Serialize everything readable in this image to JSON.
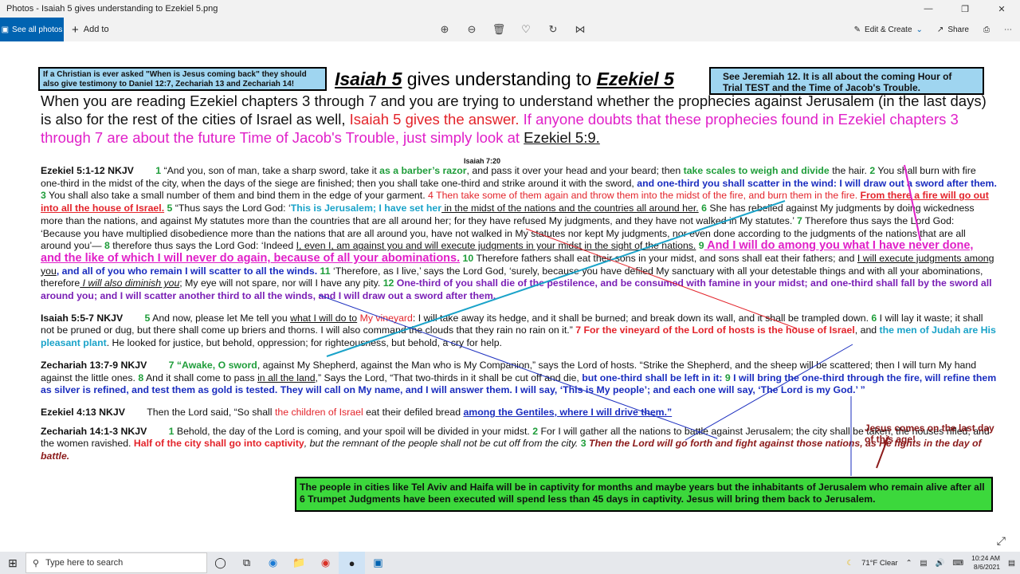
{
  "window": {
    "title": "Photos - Isaiah 5 gives understanding to Ezekiel 5.png"
  },
  "toolbar": {
    "see_all": "See all photos",
    "add_to": "Add to",
    "edit_create": "Edit & Create",
    "share": "Share"
  },
  "content": {
    "box_left": "If a Christian is ever asked \"When is Jesus coming back\" they should also give testimony to Daniel 12:7, Zechariah 13 and Zechariah 14!",
    "box_right": "See Jeremiah 12. It is all about the coming Hour of Trial TEST and the Time of Jacob's Trouble.",
    "title_a": "Isaiah 5",
    "title_mid": " gives understanding to ",
    "title_b": "Ezekiel 5",
    "intro_black": "When you are reading Ezekiel chapters 3 through 7 and you are trying to understand whether the prophecies against Jerusalem (in the last days) is also for the rest of the cities of Israel as well, ",
    "intro_red": "Isaiah 5 gives the answer.",
    "intro_mag": " If anyone doubts that these prophecies found in Ezekiel chapters 3 through 7 are about the future Time of Jacob's Trouble, just simply look at ",
    "intro_link": "Ezekiel 5:9.",
    "note_720": "Isaiah 7:20",
    "ez5": {
      "ref": "Ezekiel 5:1-12 NKJV",
      "v1": "1",
      "t1a": " “And you, son of man, take a sharp sword, take it ",
      "t1b": "as a barber’s razor",
      "t1c": ", and pass it over your head and your beard; then ",
      "t1d": "take scales to weigh and divide",
      "t1e": " the hair. ",
      "v2": "2",
      "t2a": " You shall burn with fire one-third in the midst of the city, when the days of the siege are finished; then you shall take one-third and strike around it with the sword, ",
      "t2b": "and one-third you shall scatter in the wind: I will draw out a sword after them.",
      "v3": " 3",
      "t3": " You shall also take a small number of them and bind them in the edge of your garment. ",
      "t4a": "4 Then take some of them again and throw them into the midst of the fire, and burn them in the fire. ",
      "t4b": "From there a fire will go out into all the house of Israel.",
      "v5": " 5",
      "t5a": " “Thus says the Lord God: ‘",
      "t5b": "This is Jerusalem; I have set her",
      "t5c": " in the midst of the nations and the countries all around her.",
      "v6": " 6",
      "t6": " She has rebelled against My judgments by doing wickedness more than the nations, and against My statutes more than the countries that are all around her; for they have refused My judgments, and they have not walked in My statutes.’ ",
      "v7": "7",
      "t7": " Therefore thus says the Lord God: ‘Because you have multiplied disobedience more than the nations that are all around you, have not walked in My statutes nor kept My judgments, nor even done according to the judgments of the nations that are all around you’— ",
      "v8": "8",
      "t8a": " therefore thus says the Lord God: ‘Indeed ",
      "t8b": "I, even I, am against you and will execute judgments in your midst in the sight of the nations.",
      "v9": " 9",
      "t9": " And I will do among you what I have never done, and the like of which I will never do again, because of all your abominations.",
      "v10": " 10",
      "t10a": " Therefore fathers shall eat their sons in your midst, and sons shall eat their fathers; and ",
      "t10b": "I will execute judgments among you",
      "t10c": ", and all of you who remain I will scatter to all the winds.",
      "v11": " 11",
      "t11a": " ‘Therefore, as I live,’ says the Lord God, ‘surely, because you have defiled My sanctuary with all your detestable things and with all your abominations, therefore",
      "t11b": " I will also diminish you",
      "t11c": "; My eye will not spare, nor will I have any pity. ",
      "v12": "12",
      "t12": " One-third of you shall die of the pestilence, and be consumed with famine in your midst; and one-third shall fall by the sword all around you; and I will scatter another third to all the winds, and I will draw out a sword after them."
    },
    "is5": {
      "ref": "Isaiah 5:5-7 NKJV",
      "v5": "5",
      "t5a": " And now, please let Me tell you ",
      "t5b": "what I will do to",
      "t5c": " My vineyard",
      "t5d": ": I will take away its hedge, and it shall be burned; and break down its wall, and it shall be trampled down. ",
      "v6": "6",
      "t6": " I will lay it waste; it shall not be pruned or dug, but there shall come up briers and thorns. I will also command the clouds that they rain no rain on it.” ",
      "t7a": "7 For the vineyard of the Lord of hosts is the house of Israel",
      "t7b": ", and ",
      "t7c": "the men of Judah are His pleasant plant",
      "t7d": ". He looked for justice, but behold, oppression; for righteousness, but behold, a cry for help."
    },
    "zc13": {
      "ref": "Zechariah 13:7-9 NKJV",
      "v7": "7",
      "t7a": " “Awake, O sword",
      "t7b": ", against My Shepherd, against the Man who is My Companion,” says the Lord of hosts. “Strike the Shepherd, and the sheep will be scattered; then I will turn My hand against the little ones. ",
      "v8": "8",
      "t8a": " And it shall come to pass ",
      "t8b": "in all the land,",
      "t8c": "” Says the Lord, “That two-thirds in it shall be cut off and die, ",
      "t8d": "but one-third shall be left in it:",
      "v9": " 9",
      "t9": " I will bring the one-third through the fire, will refine them as silver is refined, and test them as gold is tested. They will call on My name, and I will answer them. I will say, ‘This is My people’; and each one will say, ‘The Lord is my God.’ ”"
    },
    "ez4": {
      "ref": "Ezekiel 4:13 NKJV",
      "t1": "Then the Lord said, “So shall ",
      "t2": "the children of Israel",
      "t3": " eat their defiled bread ",
      "t4": "among the Gentiles, where I will drive them.”"
    },
    "zc14": {
      "ref": "Zechariah 14:1-3 NKJV",
      "v1": "1",
      "t1": " Behold, the day of the Lord is coming, and your spoil will be divided in your midst. ",
      "v2": "2",
      "t2a": " For I will gather all the nations to battle against Jerusalem; the city shall be taken, the houses rifled, and the women ravished. ",
      "t2b": "Half of the city shall go into captivity",
      "t2c": ", but the remnant of the people shall not be cut off from the city. ",
      "v3": "3",
      "t3": " Then the Lord will go forth and fight against those nations, as He fights in the day of battle."
    },
    "jesus_note": "Jesus comes on the last day of this age!",
    "green_box": "The people in cities like Tel Aviv and Haifa will be in captivity for months and maybe years but the inhabitants of Jerusalem who remain alive after all 6 Trumpet Judgments have been executed will spend less than 45 days in captivity. Jesus will bring them back to Jerusalem."
  },
  "taskbar": {
    "search_placeholder": "Type here to search",
    "weather": "71°F  Clear",
    "time": "10:24 AM",
    "date": "8/6/2021"
  },
  "colors": {
    "accent": "#0063b1",
    "box_blue": "#9fd5f0",
    "box_green": "#3cd83c",
    "red": "#e3242b",
    "magenta": "#e020c8"
  }
}
